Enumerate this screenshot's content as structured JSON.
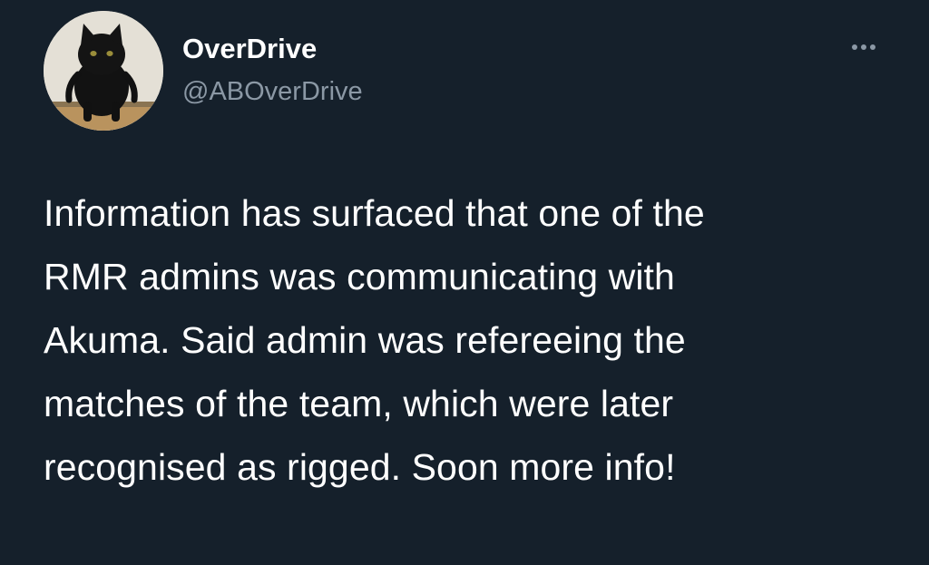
{
  "tweet": {
    "author": {
      "display_name": "OverDrive",
      "handle": "@ABOverDrive"
    },
    "more_icon": "ellipsis-icon",
    "text_lines": [
      "Information has surfaced that one of the",
      "RMR admins was communicating with",
      "Akuma. Said admin was refereeing the",
      "matches of the team, which were later",
      "recognised as rigged. Soon more info!"
    ]
  },
  "colors": {
    "background": "#15202b",
    "primary_text": "#ffffff",
    "secondary_text": "#8b98a5"
  }
}
